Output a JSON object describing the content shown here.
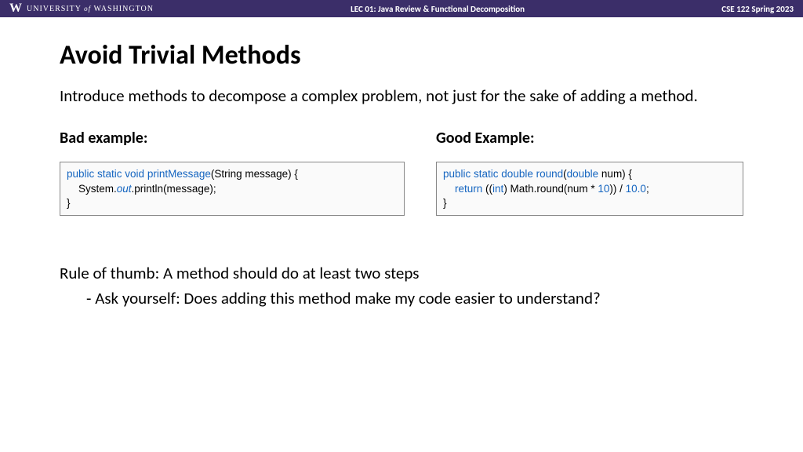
{
  "header": {
    "logo": "W",
    "university_prefix": "UNIVERSITY",
    "university_of": "of",
    "university_suffix": "WASHINGTON",
    "lecture": "LEC 01: Java Review & Functional Decomposition",
    "course": "CSE 122 Spring 2023"
  },
  "title": "Avoid Trivial Methods",
  "intro": "Introduce methods to decompose a complex problem, not just for the sake of adding a method.",
  "bad_label": "Bad example:",
  "good_label": "Good Example:",
  "bad_code": {
    "kw1": "public static void",
    "fn": " printMessage",
    "sig": "(String message) {",
    "indent": "    System.",
    "out": "out",
    "rest": ".println(message);",
    "close": "}"
  },
  "good_code": {
    "kw1": "public static",
    "ty1": " double",
    "fn": " round",
    "paren1": "(",
    "ty2": "double",
    "sig": " num) {",
    "indent": "    ",
    "ret": "return",
    "p1": " ((",
    "cast": "int",
    "p2": ") Math.round(num * ",
    "n1": "10",
    "p3": ")) / ",
    "n2": "10.0",
    "p4": ";",
    "close": "}"
  },
  "rule": "Rule of thumb: A method should do at least two steps",
  "subrule": " Ask yourself: Does adding this method make my code easier to understand?"
}
